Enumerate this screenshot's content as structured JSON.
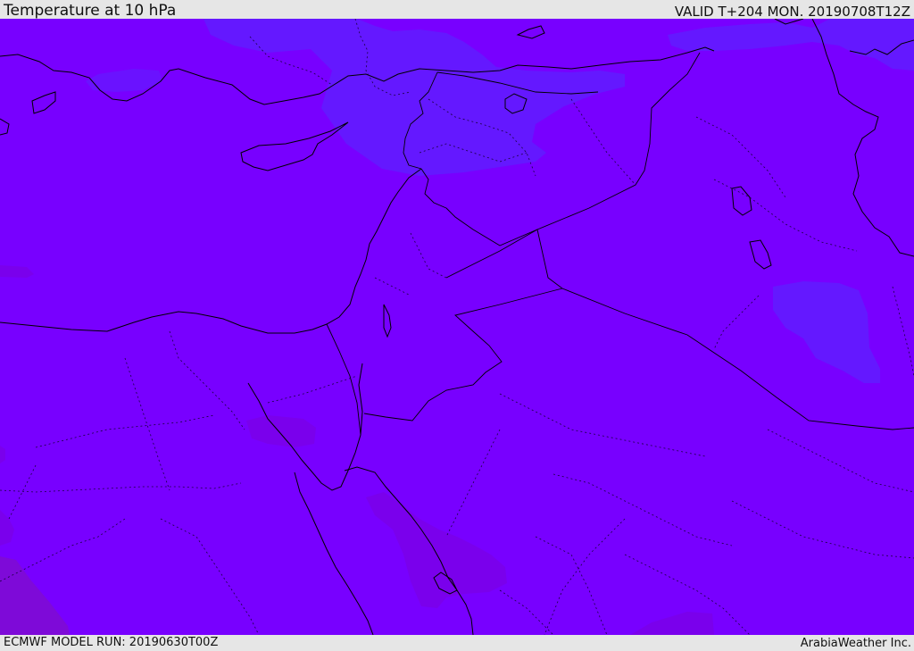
{
  "header": {
    "title": "Temperature at 10 hPa",
    "valid": "VALID T+204 MON. 20190708T12Z"
  },
  "footer": {
    "model_run": "ECMWF MODEL RUN: 20190630T00Z",
    "credit": "ArabiaWeather Inc."
  },
  "colors": {
    "base_field": "#7800ff",
    "cool_patch": "#6418ff",
    "warm_patch": "#7a00ec",
    "warmer_patch": "#7e0ad8",
    "coastline": "#000000",
    "label_bar": "#e6e6e6"
  }
}
